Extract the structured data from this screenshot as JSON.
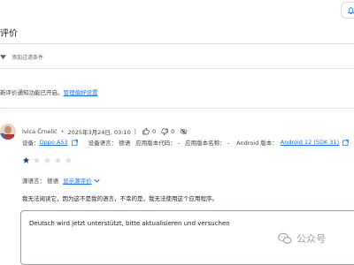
{
  "page": {
    "title": "评价"
  },
  "filter": {
    "add_filter_label": "添加过滤条件"
  },
  "notice": {
    "text": "新评价通知功能已开启。",
    "link": "管理偏好设置"
  },
  "review": {
    "author": "Ivica Črnelić",
    "date": "2025年3月24日, 03:10",
    "thumbs_up_count": "0",
    "thumbs_down_count": "0",
    "device_label": "设备：",
    "device_value": "Oppo A53",
    "device_language": "设备语言： 德语",
    "app_version_code": "应用版本代码： -",
    "app_version_name": "应用版本名称： -",
    "android_version_label": "Android 版本：",
    "android_version_value": "Android 12 (SDK 31)",
    "rating": 1,
    "rating_max": 5,
    "source_language": "源语言： 德语",
    "show_source_link": "显示源评价",
    "text": "我无法阅读它，因为这不是我的语言，不幸的是，我无法使用这个应用程序。",
    "reply_text": "Deutsch wird jetzt unterstützt, bitte aktualisieren und versuchen"
  },
  "watermark": {
    "text": "公众号"
  },
  "colors": {
    "link": "#1a73e8",
    "star_filled": "#1a3e7a",
    "star_empty": "#dadce0",
    "border": "#e0e0e0"
  }
}
